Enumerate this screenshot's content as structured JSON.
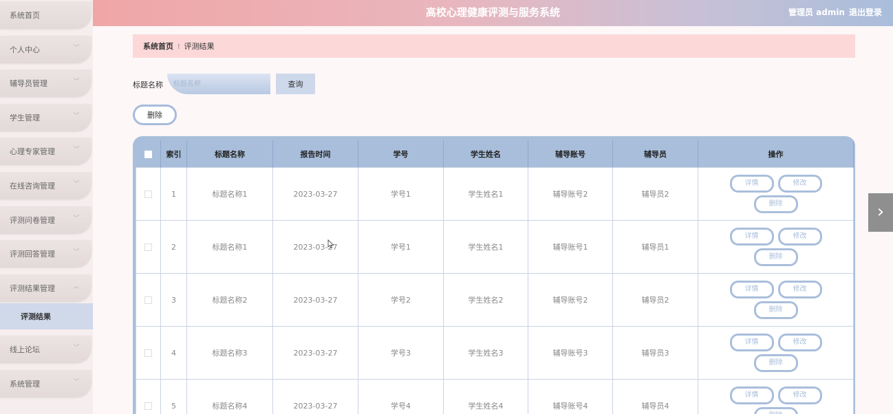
{
  "header": {
    "title": "高校心理健康评测与服务系统",
    "user": "管理员 admin",
    "logout": "退出登录"
  },
  "sidebar": {
    "items": [
      {
        "label": "系统首页"
      },
      {
        "label": "个人中心"
      },
      {
        "label": "辅导员管理"
      },
      {
        "label": "学生管理"
      },
      {
        "label": "心理专家管理"
      },
      {
        "label": "在线咨询管理"
      },
      {
        "label": "评测问卷管理"
      },
      {
        "label": "评测回答管理"
      },
      {
        "label": "评测结果管理"
      },
      {
        "label": "线上论坛"
      },
      {
        "label": "系统管理"
      }
    ],
    "submenu": "评测结果"
  },
  "breadcrumb": {
    "home": "系统首页",
    "current": "评测结果"
  },
  "search": {
    "label": "标题名称",
    "placeholder": "标题名称",
    "button": "查询"
  },
  "toolbar": {
    "delete": "删除"
  },
  "table": {
    "headers": [
      "索引",
      "标题名称",
      "报告时间",
      "学号",
      "学生姓名",
      "辅导账号",
      "辅导员",
      "操作"
    ],
    "rows": [
      {
        "index": "1",
        "title": "标题名称1",
        "time": "2023-03-27",
        "sid": "学号1",
        "name": "学生姓名1",
        "account": "辅导账号2",
        "counselor": "辅导员2"
      },
      {
        "index": "2",
        "title": "标题名称1",
        "time": "2023-03-27",
        "sid": "学号1",
        "name": "学生姓名1",
        "account": "辅导账号1",
        "counselor": "辅导员1"
      },
      {
        "index": "3",
        "title": "标题名称2",
        "time": "2023-03-27",
        "sid": "学号2",
        "name": "学生姓名2",
        "account": "辅导账号2",
        "counselor": "辅导员2"
      },
      {
        "index": "4",
        "title": "标题名称3",
        "time": "2023-03-27",
        "sid": "学号3",
        "name": "学生姓名3",
        "account": "辅导账号3",
        "counselor": "辅导员3"
      },
      {
        "index": "5",
        "title": "标题名称4",
        "time": "2023-03-27",
        "sid": "学号4",
        "name": "学生姓名4",
        "account": "辅导账号4",
        "counselor": "辅导员4"
      }
    ],
    "actions": {
      "detail": "详情",
      "edit": "修改",
      "delete": "删除"
    }
  },
  "icons": {
    "chevron": "chevron-down-icon",
    "arrow": "chevron-right-icon"
  }
}
